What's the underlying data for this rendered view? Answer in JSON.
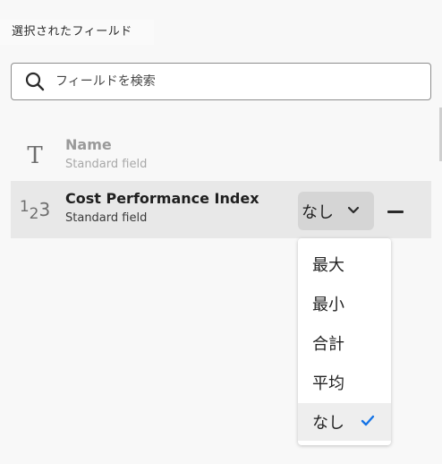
{
  "panel": {
    "title": "選択されたフィールド"
  },
  "search": {
    "placeholder": "フィールドを検索",
    "value": ""
  },
  "fields": [
    {
      "icon": "text-type-icon",
      "icon_text": "T",
      "name": "Name",
      "subtitle": "Standard field",
      "disabled": true
    },
    {
      "icon": "number-type-icon",
      "icon_text": "1₂3",
      "name": "Cost Performance Index",
      "subtitle": "Standard field",
      "aggregation": "なし",
      "disabled": false
    }
  ],
  "aggregation_menu": {
    "options": [
      "最大",
      "最小",
      "合計",
      "平均",
      "なし"
    ],
    "selected": "なし"
  },
  "colors": {
    "accent": "#1473e6",
    "selected_row": "#e8e8e8",
    "picker_bg": "#d5d5d5"
  }
}
